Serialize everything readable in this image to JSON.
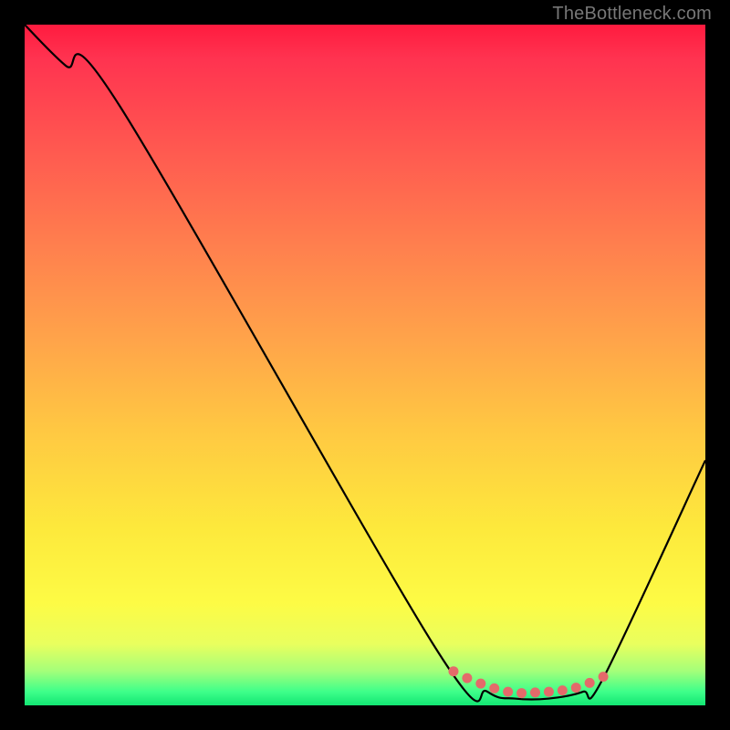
{
  "watermark": "TheBottleneck.com",
  "chart_data": {
    "type": "line",
    "title": "",
    "xlabel": "",
    "ylabel": "",
    "xlim": [
      0,
      100
    ],
    "ylim": [
      0,
      100
    ],
    "series": [
      {
        "name": "curve",
        "color": "#000000",
        "x": [
          0,
          6,
          14,
          60,
          68,
          72,
          77,
          82,
          85,
          100
        ],
        "y": [
          100,
          94,
          88,
          9,
          2,
          1,
          1,
          2,
          4,
          36
        ]
      }
    ],
    "markers": {
      "name": "highlight-segment",
      "color": "#e46a6a",
      "points": [
        {
          "x": 63,
          "y": 5
        },
        {
          "x": 65,
          "y": 4
        },
        {
          "x": 67,
          "y": 3.2
        },
        {
          "x": 69,
          "y": 2.5
        },
        {
          "x": 71,
          "y": 2.0
        },
        {
          "x": 73,
          "y": 1.8
        },
        {
          "x": 75,
          "y": 1.9
        },
        {
          "x": 77,
          "y": 2.0
        },
        {
          "x": 79,
          "y": 2.2
        },
        {
          "x": 81,
          "y": 2.6
        },
        {
          "x": 83,
          "y": 3.3
        },
        {
          "x": 85,
          "y": 4.2
        }
      ]
    }
  }
}
